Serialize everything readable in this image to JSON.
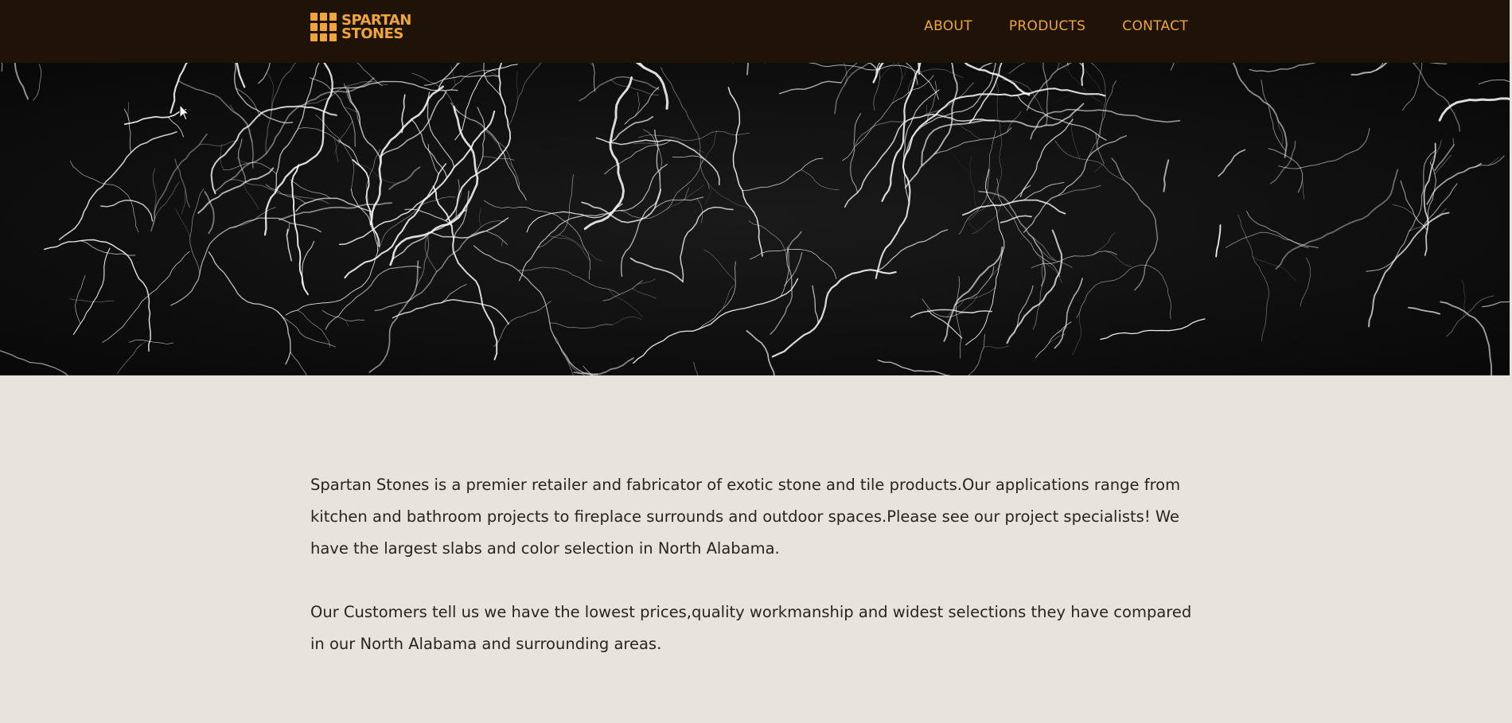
{
  "header": {
    "logo": {
      "line1": "SPARTAN",
      "line2": "STONES"
    },
    "nav": [
      {
        "label": "ABOUT"
      },
      {
        "label": "PRODUCTS"
      },
      {
        "label": "CONTACT"
      }
    ]
  },
  "content": {
    "paragraphs": [
      "Spartan Stones is a premier retailer and fabricator of exotic stone and tile products.Our applications range from kitchen and bathroom projects to fireplace surrounds and outdoor spaces.Please see our project specialists! We have the largest slabs and color selection in North Alabama.",
      "Our Customers tell us we have the lowest prices,quality workmanship and widest selections they have compared in our North Alabama and surrounding areas."
    ]
  },
  "colors": {
    "header_bg": "#1e1306",
    "accent": "#f0a53a",
    "page_bg": "#e8e3dc",
    "text": "#2a241c"
  },
  "icons": [
    "logo-grid-icon",
    "mouse-cursor-icon"
  ]
}
